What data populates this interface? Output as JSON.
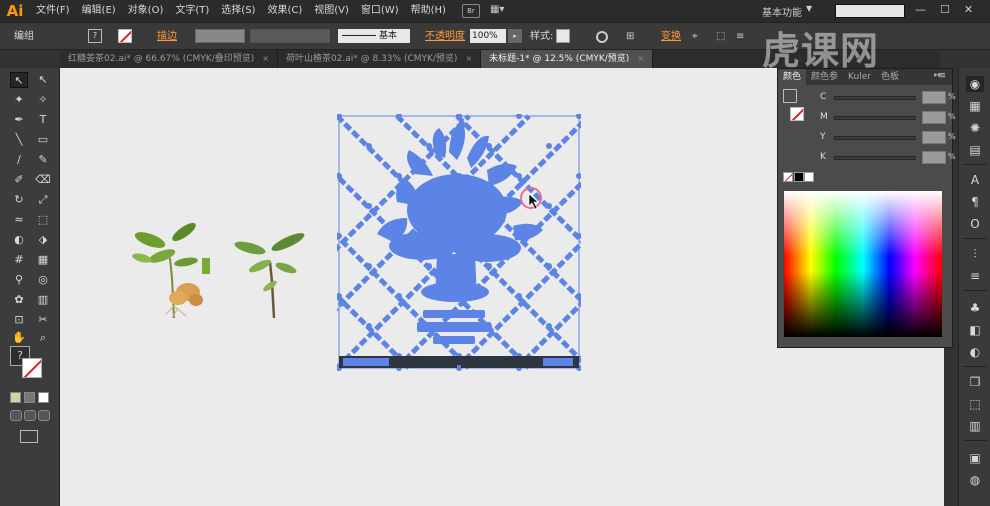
{
  "app": {
    "logo": "Ai"
  },
  "menubar": {
    "items": [
      "文件(F)",
      "编辑(E)",
      "对象(O)",
      "文字(T)",
      "选择(S)",
      "效果(C)",
      "视图(V)",
      "窗口(W)",
      "帮助(H)"
    ],
    "bridge_label": "Br",
    "workspace_label": "基本功能",
    "workspace_dropdown": "▼",
    "search_placeholder": "",
    "minimize": "—",
    "maximize": "☐",
    "close": "✕"
  },
  "controlbar": {
    "selection_label": "编组",
    "fill_glyph": "?",
    "stroke_label": "描边",
    "brush_label": "基本",
    "opacity_label": "不透明度",
    "opacity_value": "100%",
    "opacity_dropdown": "▸",
    "style_label": "样式:",
    "transform_label": "变换",
    "align_glyph": "⊞",
    "isolate_glyph": "⌖",
    "extra1_glyph": "⬚",
    "extra2_glyph": "≡"
  },
  "tabs": [
    {
      "label": "红糖姜茶02.ai* @ 66.67% (CMYK/叠印预览)",
      "close": "×",
      "active": false
    },
    {
      "label": "荷叶山楂茶02.ai* @ 8.33% (CMYK/预览)",
      "close": "×",
      "active": false
    },
    {
      "label": "未标题-1* @ 12.5% (CMYK/预览)",
      "close": "×",
      "active": true
    }
  ],
  "tools": {
    "selection": "↖",
    "direct": "↖",
    "magic": "✦",
    "lasso": "✧",
    "pen": "✒",
    "type": "T",
    "line": "╲",
    "rect": "▭",
    "brush": "∕",
    "pencil": "✎",
    "blob": "✐",
    "eraser": "⌫",
    "rotate": "↻",
    "scale": "⤢",
    "warp": "≈",
    "freetransform": "⬚",
    "shapebuilder": "◐",
    "perspective": "⬗",
    "mesh": "#",
    "gradient": "▦",
    "eyedropper": "⚲",
    "blend": "◎",
    "symbol": "✿",
    "graph": "▥",
    "artboard": "⊡",
    "slice": "✂",
    "hand": "✋",
    "zoom": "🔍",
    "fill_glyph": "?"
  },
  "color_panel": {
    "tabs": [
      "颜色",
      "颜色参",
      "Kuler",
      "色板"
    ],
    "menu_glyph": "≡",
    "collapse_glyph": "▸▸",
    "channels": [
      "C",
      "M",
      "Y",
      "K"
    ],
    "percent": "%"
  },
  "right_dock_icons": [
    "color-guide",
    "swatches",
    "brushes",
    "symbols",
    "graphic-styles",
    "character",
    "paragraph",
    "opentype",
    "align",
    "transform",
    "pathfinder",
    "stroke",
    "gradient",
    "transparency",
    "appearance",
    "layers",
    "artboards",
    "links",
    "export"
  ],
  "watermark": "虎课网",
  "colors": {
    "accent_orange": "#ff9a3c",
    "logo_orange": "#ff9a00",
    "selection_blue": "#5b84e6",
    "pot_dark": "#2d3541",
    "canvas": "#ebebeb"
  }
}
